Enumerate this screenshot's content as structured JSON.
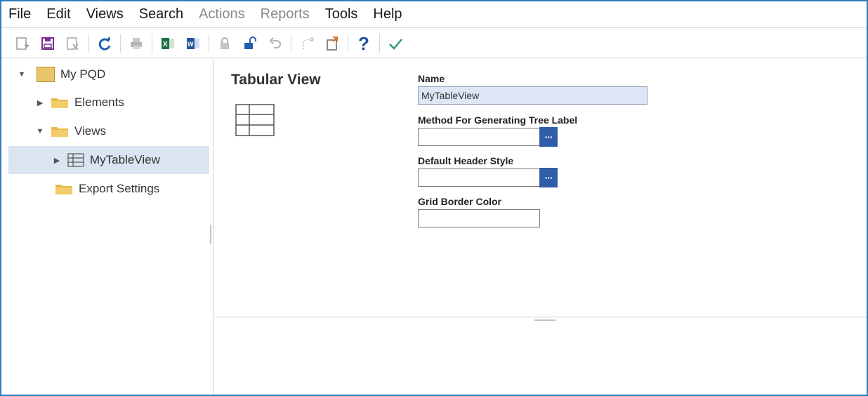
{
  "menu": {
    "items": [
      {
        "label": "File",
        "enabled": true
      },
      {
        "label": "Edit",
        "enabled": true
      },
      {
        "label": "Views",
        "enabled": true
      },
      {
        "label": "Search",
        "enabled": true
      },
      {
        "label": "Actions",
        "enabled": false
      },
      {
        "label": "Reports",
        "enabled": false
      },
      {
        "label": "Tools",
        "enabled": true
      },
      {
        "label": "Help",
        "enabled": true
      }
    ]
  },
  "toolbar": {
    "icons": [
      "new-icon",
      "save-icon",
      "delete-icon",
      "refresh-icon",
      "print-icon",
      "excel-icon",
      "word-icon",
      "lock-icon",
      "unlock-icon",
      "undo-icon",
      "redo-icon",
      "export-icon",
      "help-icon",
      "check-icon"
    ]
  },
  "tree": {
    "root": "My PQD",
    "elements": "Elements",
    "views": "Views",
    "selected_view": "MyTableView",
    "export_settings": "Export Settings"
  },
  "detail": {
    "title": "Tabular View",
    "name_label": "Name",
    "name_value": "MyTableView",
    "method_label": "Method For Generating Tree Label",
    "method_value": "",
    "header_style_label": "Default Header Style",
    "header_style_value": "",
    "border_color_label": "Grid Border Color",
    "border_color_value": "",
    "ellipsis": "···"
  },
  "colors": {
    "accent": "#2f5da8",
    "selection": "#dbe4f0",
    "frame": "#2d7dbf",
    "folder": "#e8b84a"
  }
}
